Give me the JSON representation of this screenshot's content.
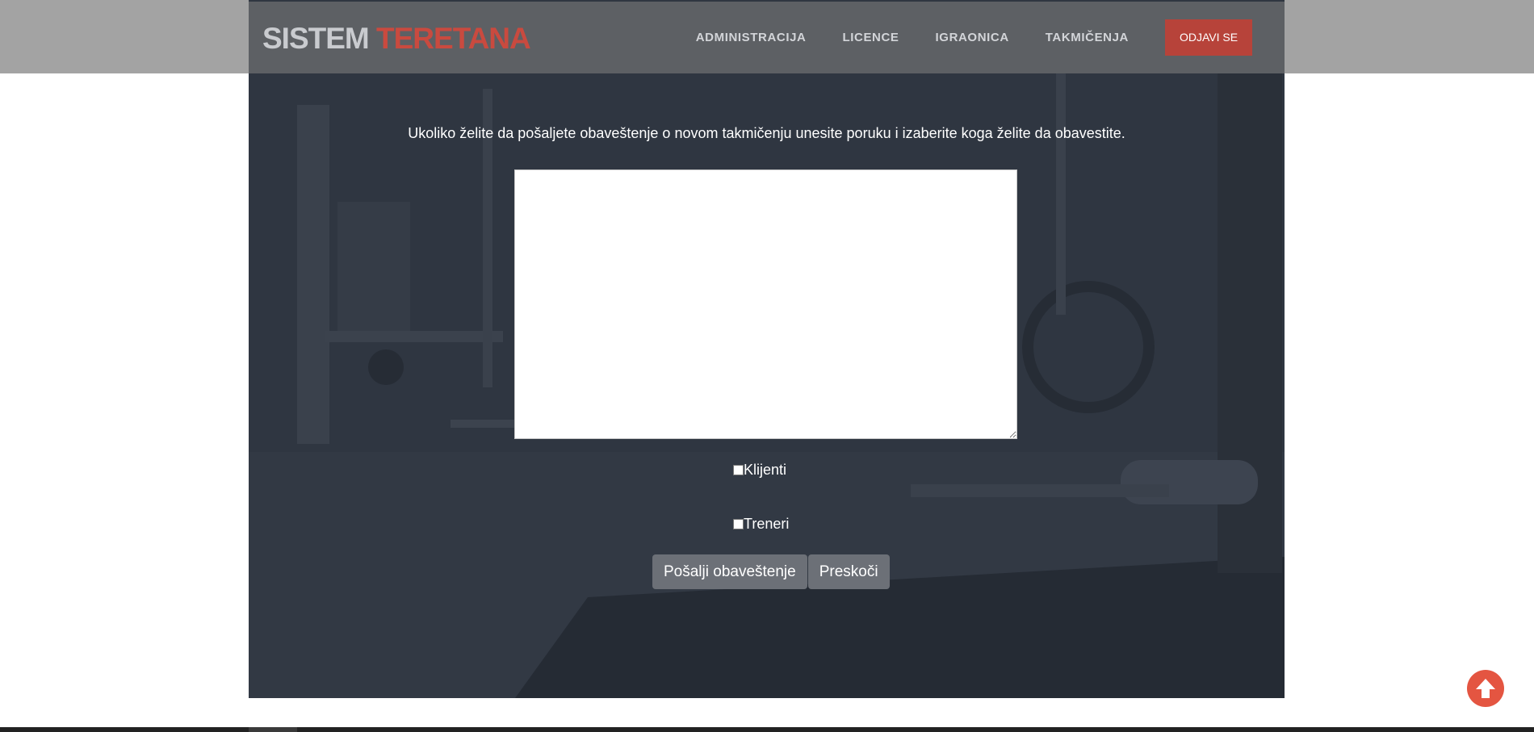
{
  "brand": {
    "part1": "SISTEM",
    "part2": "TERETANA"
  },
  "nav": {
    "items": [
      {
        "label": "ADMINISTRACIJA"
      },
      {
        "label": "LICENCE"
      },
      {
        "label": "IGRAONICA"
      },
      {
        "label": "TAKMIČENJA"
      }
    ],
    "logout_label": "ODJAVI SE"
  },
  "form": {
    "prompt": "Ukoliko želite da pošaljete obaveštenje o novom takmičenju unesite poruku i izaberite koga želite da obavestite.",
    "message_value": "",
    "checkboxes": [
      {
        "label": "Klijenti",
        "checked": false
      },
      {
        "label": "Treneri",
        "checked": false
      }
    ],
    "send_label": "Pošalji obaveštenje",
    "skip_label": "Preskoči"
  },
  "icons": {
    "scroll_top": "arrow-circle-up-icon"
  },
  "colors": {
    "accent": "#c94a3f",
    "logout_bg": "#b7433a",
    "hero_bg": "#2e3540",
    "header_bg": "#5d6064",
    "button_bg": "#6c7077",
    "scroll_top": "#e45541"
  }
}
